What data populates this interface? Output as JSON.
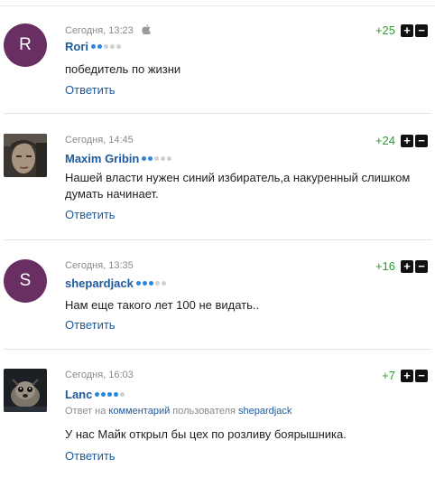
{
  "comments": [
    {
      "author": "Rori",
      "avatar_letter": "R",
      "timestamp": "Сегодня, 13:23",
      "device_icon": "apple-icon",
      "rating_dots": 2,
      "score": "+25",
      "text": "победитель по жизни",
      "reply_label": "Ответить"
    },
    {
      "author": "Maxim Gribin",
      "timestamp": "Сегодня, 14:45",
      "rating_dots": 2,
      "score": "+24",
      "text": "Нашей власти нужен синий избиратель,а накуренный слишком думать начинает.",
      "reply_label": "Ответить"
    },
    {
      "author": "shepardjack",
      "avatar_letter": "S",
      "timestamp": "Сегодня, 13:35",
      "rating_dots": 3,
      "score": "+16",
      "text": "Нам еще такого лет 100 не видать..",
      "reply_label": "Ответить"
    },
    {
      "author": "Lanc",
      "timestamp": "Сегодня, 16:03",
      "rating_dots": 4,
      "score": "+7",
      "reply_note": {
        "prefix": "Ответ на ",
        "link": "комментарий",
        "middle": " пользователя ",
        "user": "shepardjack"
      },
      "text": "У нас Майк открыл бы цех по розливу боярышника.",
      "reply_label": "Ответить"
    }
  ],
  "vote_up_symbol": "+",
  "vote_down_symbol": "−",
  "colors": {
    "link": "#1e5a9a",
    "score": "#2e9a2e",
    "avatar_bg": "#6a2f62",
    "dot_on": "#2a86e0"
  }
}
